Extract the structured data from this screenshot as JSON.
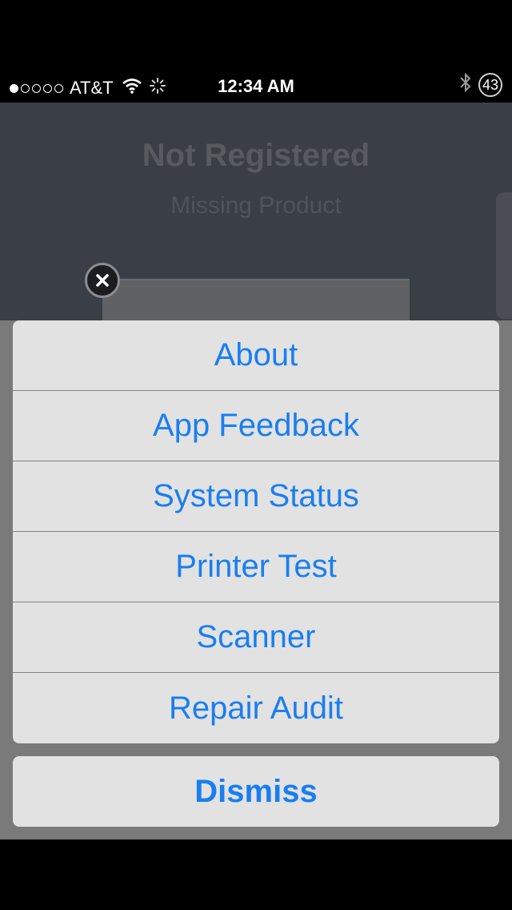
{
  "status_bar": {
    "signal_filled": 1,
    "signal_total": 5,
    "carrier": "AT&T",
    "time": "12:34 AM",
    "battery": "43",
    "icons": [
      "wifi-icon",
      "activity-spinner-icon",
      "bluetooth-icon"
    ]
  },
  "background": {
    "title": "Not Registered",
    "subtitle": "Missing Product"
  },
  "action_sheet": {
    "items": [
      {
        "label": "About"
      },
      {
        "label": "App Feedback"
      },
      {
        "label": "System Status"
      },
      {
        "label": "Printer Test"
      },
      {
        "label": "Scanner"
      },
      {
        "label": "Repair Audit"
      }
    ],
    "dismiss_label": "Dismiss"
  },
  "colors": {
    "accent": "#1a7ef0",
    "sheet_background": "#e2e2e2",
    "dim_overlay": "#7a7a7a"
  }
}
